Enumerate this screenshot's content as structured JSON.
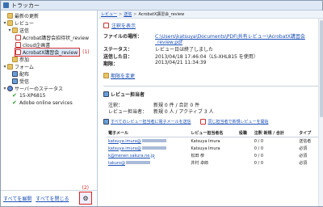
{
  "window": {
    "title": "トラッカー"
  },
  "tree": {
    "recent": "最新の更新",
    "review": "レビュー",
    "sent": "送信",
    "item1": "Acrobat講習会招待状_review",
    "item2": "cloud企画書",
    "item3": "AcrobatX講習会_review",
    "callout1": "(1)",
    "join": "参加",
    "forms": "フォーム",
    "distributed": "配布",
    "received": "受信",
    "server_status": "サーバーのステータス",
    "server1": "15-XP6815",
    "server2": "Adobe online services"
  },
  "left_footer": {
    "expand_all": "すべてを展開",
    "collapse_all": "すべてを閉じる",
    "callout2": "(2)",
    "icon": "settings-icon"
  },
  "breadcrumb": {
    "items": [
      "レビュー",
      "送信",
      "AcrobatX講習会_review"
    ]
  },
  "header": {
    "link": "注釈を表示"
  },
  "props": {
    "file_label": "ファイルの場所：",
    "file_value": "C:\\Users\\katsuya\\Documents\\PDF\\共有レビュー\\AcrobatX講習会_review.pdf",
    "status_label": "ステータス：",
    "status_value": "レビュー日は終了しました",
    "sent_label": "送信した日：",
    "sent_value": "2013/04/18 17:46:04（LS-XHL815 を使用）",
    "deadline_label": "期限：",
    "deadline_value": "2013/04/21 11:34:39"
  },
  "change_deadline": "期限を変更",
  "reviewers_section": {
    "title": "レビュー担当者",
    "comments_label": "注釈：",
    "comments_value": "新規 0 件 / 合計 0 件",
    "reviewers_label": "レビュー担当者：",
    "reviewers_value": "新規 0 人 / アクティブ 3 人"
  },
  "actions": {
    "email_all": "すべてのレビュー担当者に電子メールを送信",
    "start_same": "同じ担当者で新規レビューを開始"
  },
  "table": {
    "headers": [
      "電子メール",
      "レビュー担当者名",
      "役職",
      "注釈 新規 / 合計",
      "タイプ"
    ],
    "rows": [
      {
        "email": "katsuya.imura@",
        "name": "Katsuya Imura",
        "title": "",
        "comments": "0 / 0",
        "type": "送信者"
      },
      {
        "email": "katsuya.imura@",
        "name": "Katsuya Imura",
        "title": "",
        "comments": "0 / 0",
        "type": "必須"
      },
      {
        "email": "k@menen.sakura.ne.jp",
        "name": "松田 恭",
        "title": "",
        "comments": "0 / 0",
        "type": "必須"
      },
      {
        "email": "takuro@",
        "name": "井村 卓郎",
        "title": "",
        "comments": "0 / 0",
        "type": "必須"
      }
    ]
  },
  "colors": {
    "accent": "#1a4fb5",
    "callout": "#dd2222",
    "panel_border": "#b8c7d9"
  }
}
